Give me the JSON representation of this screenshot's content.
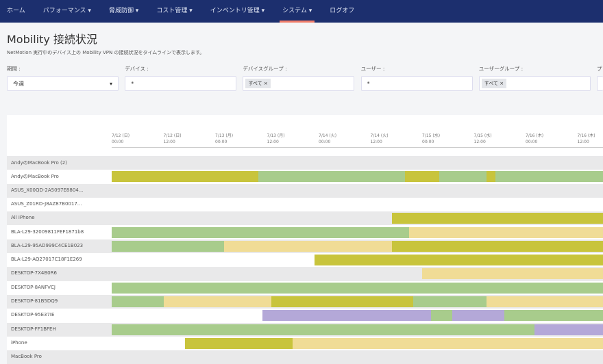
{
  "nav": {
    "items": [
      "ホーム",
      "パフォーマンス ▾",
      "脅威防御 ▾",
      "コスト管理 ▾",
      "インベントリ管理 ▾",
      "システム ▾",
      "ログオフ"
    ],
    "active": 5
  },
  "page": {
    "title": "Mobility 接続状況",
    "subtitle": "NetMotion 実行中のデバイス上の Mobility VPN の接続状況をタイムラインで表示します。"
  },
  "filters": [
    {
      "label": "期間 :",
      "value": "今週",
      "type": "select"
    },
    {
      "label": "デバイス :",
      "value": "*",
      "type": "text"
    },
    {
      "label": "デバイスグループ :",
      "value": "すべて ×",
      "type": "tag"
    },
    {
      "label": "ユーザー :",
      "value": "*",
      "type": "text"
    },
    {
      "label": "ユーザーグループ :",
      "value": "すべて ×",
      "type": "tag"
    },
    {
      "label": "プ",
      "value": "",
      "type": "text"
    }
  ],
  "colors": {
    "connected": "#a8cc8c",
    "active": "#c8c43c",
    "idle": "#f0dc96",
    "suspended": "#b4a8d8"
  },
  "timeline": {
    "ticks": [
      [
        "7/12 (日)",
        "00:00"
      ],
      [
        "7/12 (日)",
        "12:00"
      ],
      [
        "7/13 (月)",
        "00:00"
      ],
      [
        "7/13 (月)",
        "12:00"
      ],
      [
        "7/14 (火)",
        "00:00"
      ],
      [
        "7/14 (火)",
        "12:00"
      ],
      [
        "7/15 (水)",
        "00:00"
      ],
      [
        "7/15 (水)",
        "12:00"
      ],
      [
        "7/16 (木)",
        "00:00"
      ],
      [
        "7/16 (木)",
        "12:00"
      ]
    ],
    "rows": [
      {
        "name": "AndyのMacBook Pro (2)",
        "segments": []
      },
      {
        "name": "AndyのMacBook Pro",
        "segments": [
          [
            "7/12 00:00",
            "7/13 10:00",
            "active"
          ],
          [
            "7/13 10:00",
            "7/16 18:00",
            "connected"
          ],
          [
            "7/14 20:00",
            "7/15 04:00",
            "active"
          ],
          [
            "7/15 15:00",
            "7/15 17:00",
            "active"
          ]
        ]
      },
      {
        "name": "ASUS_X00QD-2A5097E8804...",
        "segments": []
      },
      {
        "name": "ASUS_Z01RD-J8AZ87B0017...",
        "segments": []
      },
      {
        "name": "All iPhone",
        "segments": [
          [
            "7/14 17:00",
            "7/16 18:00",
            "active"
          ]
        ]
      },
      {
        "name": "BLA-L29-32009811FEF1871b8",
        "segments": [
          [
            "7/12 00:00",
            "7/14 21:00",
            "connected"
          ],
          [
            "7/14 21:00",
            "7/16 18:00",
            "idle"
          ]
        ]
      },
      {
        "name": "BLA-L29-95AD999C4CE1B023",
        "segments": [
          [
            "7/12 00:00",
            "7/13 02:00",
            "connected"
          ],
          [
            "7/13 02:00",
            "7/14 17:00",
            "idle"
          ],
          [
            "7/14 17:00",
            "7/16 18:00",
            "active"
          ]
        ]
      },
      {
        "name": "BLA-L29-AQ27017C18F1E269",
        "segments": [
          [
            "7/13 23:00",
            "7/16 18:00",
            "active"
          ]
        ]
      },
      {
        "name": "DESKTOP-7X4B0R6",
        "segments": [
          [
            "7/15 00:00",
            "7/16 18:00",
            "idle"
          ]
        ]
      },
      {
        "name": "DESKTOP-8ANFVCJ",
        "segments": [
          [
            "7/12 00:00",
            "7/16 18:00",
            "connected"
          ]
        ]
      },
      {
        "name": "DESKTOP-81B5DQ9",
        "segments": [
          [
            "7/12 00:00",
            "7/12 12:00",
            "connected"
          ],
          [
            "7/12 12:00",
            "7/13 13:00",
            "idle"
          ],
          [
            "7/13 13:00",
            "7/14 22:00",
            "active"
          ],
          [
            "7/14 22:00",
            "7/15 15:00",
            "connected"
          ],
          [
            "7/15 15:00",
            "7/16 18:00",
            "idle"
          ]
        ]
      },
      {
        "name": "DESKTOP-95E37IE",
        "segments": [
          [
            "7/13 11:00",
            "7/15 02:00",
            "suspended"
          ],
          [
            "7/15 02:00",
            "7/15 07:00",
            "connected"
          ],
          [
            "7/15 07:00",
            "7/15 19:00",
            "suspended"
          ],
          [
            "7/15 19:00",
            "7/16 18:00",
            "connected"
          ]
        ]
      },
      {
        "name": "DESKTOP-FF1BFEH",
        "segments": [
          [
            "7/12 00:00",
            "7/16 02:00",
            "connected"
          ],
          [
            "7/16 02:00",
            "7/16 18:00",
            "suspended"
          ]
        ]
      },
      {
        "name": "iPhone",
        "segments": [
          [
            "7/12 17:00",
            "7/13 18:00",
            "active"
          ],
          [
            "7/13 18:00",
            "7/16 18:00",
            "idle"
          ]
        ]
      },
      {
        "name": "MacBook Pro",
        "segments": []
      }
    ]
  }
}
